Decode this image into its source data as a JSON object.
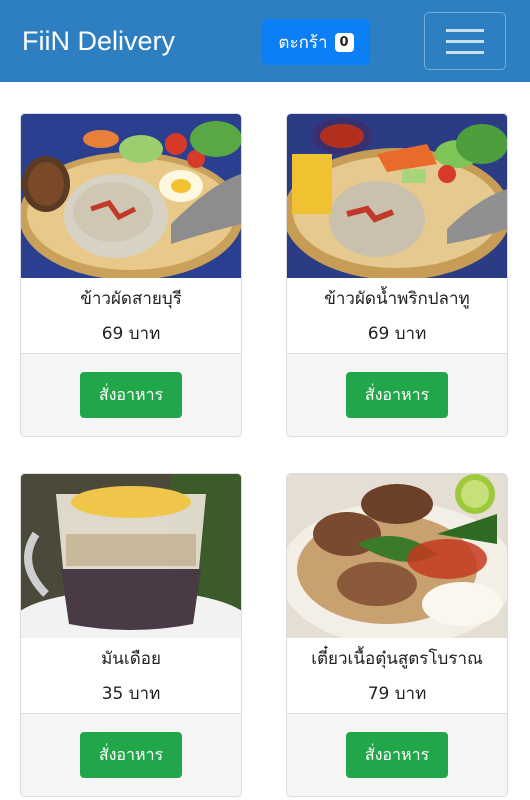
{
  "navbar": {
    "brand": "FiiN Delivery",
    "cart_label": "ตะกร้า",
    "cart_count": "0",
    "menu_icon": "hamburger-icon"
  },
  "colors": {
    "navbar_bg": "#2e7fc1",
    "cart_button": "#0d7ff5",
    "order_button": "#22a64a"
  },
  "products": [
    {
      "name": "ข้าวผัดสายบุรี",
      "price": "69 บาท",
      "order_label": "สั่งอาหาร"
    },
    {
      "name": "ข้าวผัดน้ำพริกปลาทู",
      "price": "69 บาท",
      "order_label": "สั่งอาหาร"
    },
    {
      "name": "มันเดือย",
      "price": "35 บาท",
      "order_label": "สั่งอาหาร"
    },
    {
      "name": "เตี๋ยวเนื้อตุ๋นสูตรโบราณ",
      "price": "79 บาท",
      "order_label": "สั่งอาหาร"
    }
  ]
}
